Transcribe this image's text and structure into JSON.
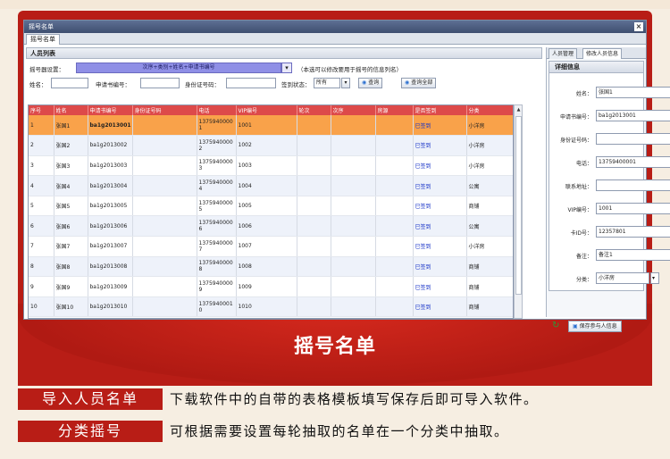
{
  "window": {
    "title": "摇号名单",
    "tab": "摇号名单",
    "close_icon": "close-icon"
  },
  "left": {
    "panel_title": "人员列表",
    "name_format_label": "摇号器设置：",
    "name_format_value": "次序+类别+姓名+申请书编号",
    "name_format_hint": "（本选可以修改要用于摇号的信息列名）",
    "filters": {
      "name_label": "姓名：",
      "app_no_label": "申请书编号：",
      "id_no_label": "身份证号码：",
      "sign_status_label": "签到状态：",
      "sign_status_value": "所有",
      "query_button": "查询",
      "query_all_button": "查询全部"
    },
    "columns": [
      "序号",
      "姓名",
      "申请书编号",
      "身份证号码",
      "电话",
      "VIP编号",
      "轮次",
      "次序",
      "房源",
      "是否签到",
      "分类"
    ],
    "rows": [
      [
        "1",
        "张国1",
        "ba1g2013001",
        "",
        "1375940000 1",
        "1001",
        "",
        "",
        "",
        "已签到",
        "小洋房"
      ],
      [
        "2",
        "张国2",
        "ba1g2013002",
        "",
        "1375940000 2",
        "1002",
        "",
        "",
        "",
        "已签到",
        "小洋房"
      ],
      [
        "3",
        "张国3",
        "ba1g2013003",
        "",
        "1375940000 3",
        "1003",
        "",
        "",
        "",
        "已签到",
        "小洋房"
      ],
      [
        "4",
        "张国4",
        "ba1g2013004",
        "",
        "1375940000 4",
        "1004",
        "",
        "",
        "",
        "已签到",
        "公寓"
      ],
      [
        "5",
        "张国5",
        "ba1g2013005",
        "",
        "1375940000 5",
        "1005",
        "",
        "",
        "",
        "已签到",
        "商铺"
      ],
      [
        "6",
        "张国6",
        "ba1g2013006",
        "",
        "1375940000 6",
        "1006",
        "",
        "",
        "",
        "已签到",
        "公寓"
      ],
      [
        "7",
        "张国7",
        "ba1g2013007",
        "",
        "1375940000 7",
        "1007",
        "",
        "",
        "",
        "已签到",
        "小洋房"
      ],
      [
        "8",
        "张国8",
        "ba1g2013008",
        "",
        "1375940000 8",
        "1008",
        "",
        "",
        "",
        "已签到",
        "商铺"
      ],
      [
        "9",
        "张国9",
        "ba1g2013009",
        "",
        "1375940000 9",
        "1009",
        "",
        "",
        "",
        "已签到",
        "商铺"
      ],
      [
        "10",
        "张国10",
        "ba1g2013010",
        "",
        "1375940001 0",
        "1010",
        "",
        "",
        "",
        "已签到",
        "商铺"
      ]
    ]
  },
  "right": {
    "tab_manage": "人员管理",
    "tab_info": "修改人员信息",
    "section_title": "详细信息",
    "fields": [
      {
        "label": "姓名：",
        "value": "张国1"
      },
      {
        "label": "申请书编号：",
        "value": "ba1g2013001"
      },
      {
        "label": "身份证号码：",
        "value": ""
      },
      {
        "label": "电话：",
        "value": "13759400001"
      },
      {
        "label": "联系地址：",
        "value": ""
      },
      {
        "label": "VIP编号：",
        "value": "1001"
      },
      {
        "label": "卡ID号：",
        "value": "12357801"
      },
      {
        "label": "备注：",
        "value": "备注1"
      },
      {
        "label": "分类：",
        "value": "小洋房"
      }
    ],
    "save_button": "保存参与人信息"
  },
  "banner": {
    "title": "摇号名单"
  },
  "descriptions": [
    {
      "tag": "导入人员名单",
      "text": "下载软件中的自带的表格模板填写保存后即可导入软件。"
    },
    {
      "tag": "分类摇号",
      "text": "可根据需要设置每轮抽取的名单在一个分类中抽取。"
    }
  ],
  "colors": {
    "brand_red": "#b81d16",
    "header_red": "#dd4a4a",
    "selected_row": "#f9a24a",
    "signed_blue": "#1a35c8"
  }
}
